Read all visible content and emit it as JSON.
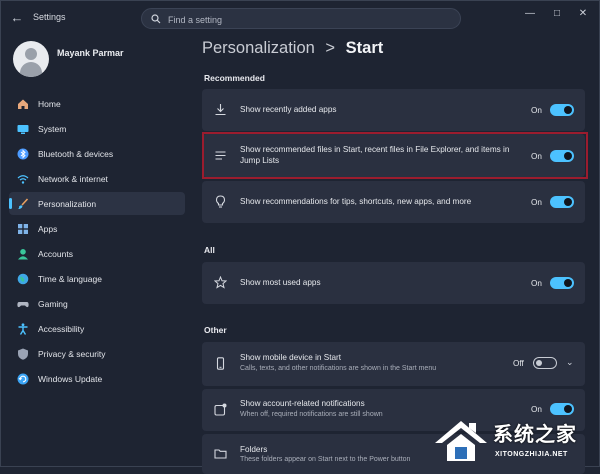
{
  "window": {
    "title": "Settings"
  },
  "search": {
    "placeholder": "Find a setting"
  },
  "user": {
    "name": "Mayank Parmar"
  },
  "sidebar": {
    "items": [
      {
        "label": "Home",
        "icon": "home-icon",
        "color": "#e8a87c"
      },
      {
        "label": "System",
        "icon": "system-icon",
        "color": "#4cc2ff"
      },
      {
        "label": "Bluetooth & devices",
        "icon": "bluetooth-icon",
        "color": "#4c9bff"
      },
      {
        "label": "Network & internet",
        "icon": "wifi-icon",
        "color": "#4cc2ff"
      },
      {
        "label": "Personalization",
        "icon": "brush-icon",
        "color": "#e8a060",
        "active": true
      },
      {
        "label": "Apps",
        "icon": "apps-icon",
        "color": "#7fb3e8"
      },
      {
        "label": "Accounts",
        "icon": "accounts-icon",
        "color": "#3ac59a"
      },
      {
        "label": "Time & language",
        "icon": "globe-icon",
        "color": "#3fa8e6"
      },
      {
        "label": "Gaming",
        "icon": "gaming-icon",
        "color": "#b0b6c2"
      },
      {
        "label": "Accessibility",
        "icon": "accessibility-icon",
        "color": "#4cc2ff"
      },
      {
        "label": "Privacy & security",
        "icon": "shield-icon",
        "color": "#9aa3b4"
      },
      {
        "label": "Windows Update",
        "icon": "update-icon",
        "color": "#3ba4f5"
      }
    ]
  },
  "breadcrumb": {
    "parent": "Personalization",
    "separator": ">",
    "current": "Start"
  },
  "sections": {
    "recommended": {
      "title": "Recommended",
      "rows": [
        {
          "text": "Show recently added apps",
          "state": "On",
          "on": true
        },
        {
          "text": "Show recommended files in Start, recent files in File Explorer, and items in Jump Lists",
          "state": "On",
          "on": true
        },
        {
          "text": "Show recommendations for tips, shortcuts, new apps, and more",
          "state": "On",
          "on": true
        }
      ]
    },
    "all": {
      "title": "All",
      "rows": [
        {
          "text": "Show most used apps",
          "state": "On",
          "on": true
        }
      ]
    },
    "other": {
      "title": "Other",
      "rows": [
        {
          "text": "Show mobile device in Start",
          "sub": "Calls, texts, and other notifications are shown in the Start menu",
          "state": "Off",
          "on": false
        },
        {
          "text": "Show account-related notifications",
          "sub": "When off, required notifications are still shown",
          "state": "On",
          "on": true
        },
        {
          "text": "Folders",
          "sub": "These folders appear on Start next to the Power button"
        }
      ]
    }
  },
  "watermark": {
    "chinese": "系统之家",
    "latin": "XITONGZHIJIA.NET"
  },
  "colors": {
    "accent": "#4cc2ff",
    "highlight": "#9b1c2e",
    "background": "#1e2432",
    "card": "#2a3040"
  }
}
